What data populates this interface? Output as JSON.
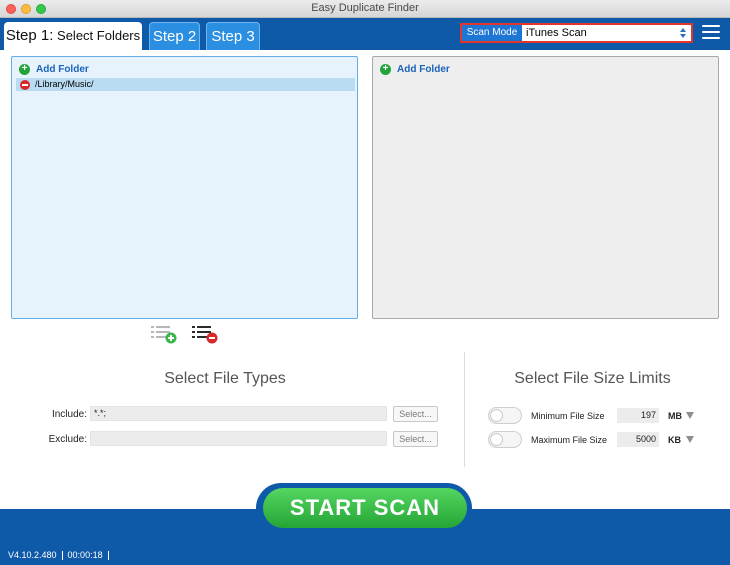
{
  "window": {
    "title": "Easy Duplicate Finder"
  },
  "tabs": {
    "step1_prefix": "Step 1:",
    "step1_label": "Select Folders",
    "step2": "Step 2",
    "step3": "Step 3"
  },
  "scan_mode": {
    "label": "Scan Mode",
    "value": "iTunes Scan"
  },
  "left_panel": {
    "add_folder": "Add Folder",
    "folders": [
      "/Library/Music/"
    ]
  },
  "right_panel": {
    "add_folder": "Add Folder"
  },
  "file_types": {
    "title": "Select File Types",
    "include_label": "Include:",
    "include_value": "*.*;",
    "exclude_label": "Exclude:",
    "exclude_value": "",
    "select_label": "Select..."
  },
  "size_limits": {
    "title": "Select File Size Limits",
    "min_label": "Minimum File Size",
    "min_value": "197",
    "min_unit": "MB",
    "max_label": "Maximum File Size",
    "max_value": "5000",
    "max_unit": "KB"
  },
  "start_button": "START  SCAN",
  "status": {
    "version": "V4.10.2.480",
    "elapsed": "00:00:18"
  },
  "colors": {
    "accent": "#0f5aa8",
    "tab_inactive": "#2a8fe0",
    "start": "#25a535",
    "highlight": "#e0342c"
  }
}
